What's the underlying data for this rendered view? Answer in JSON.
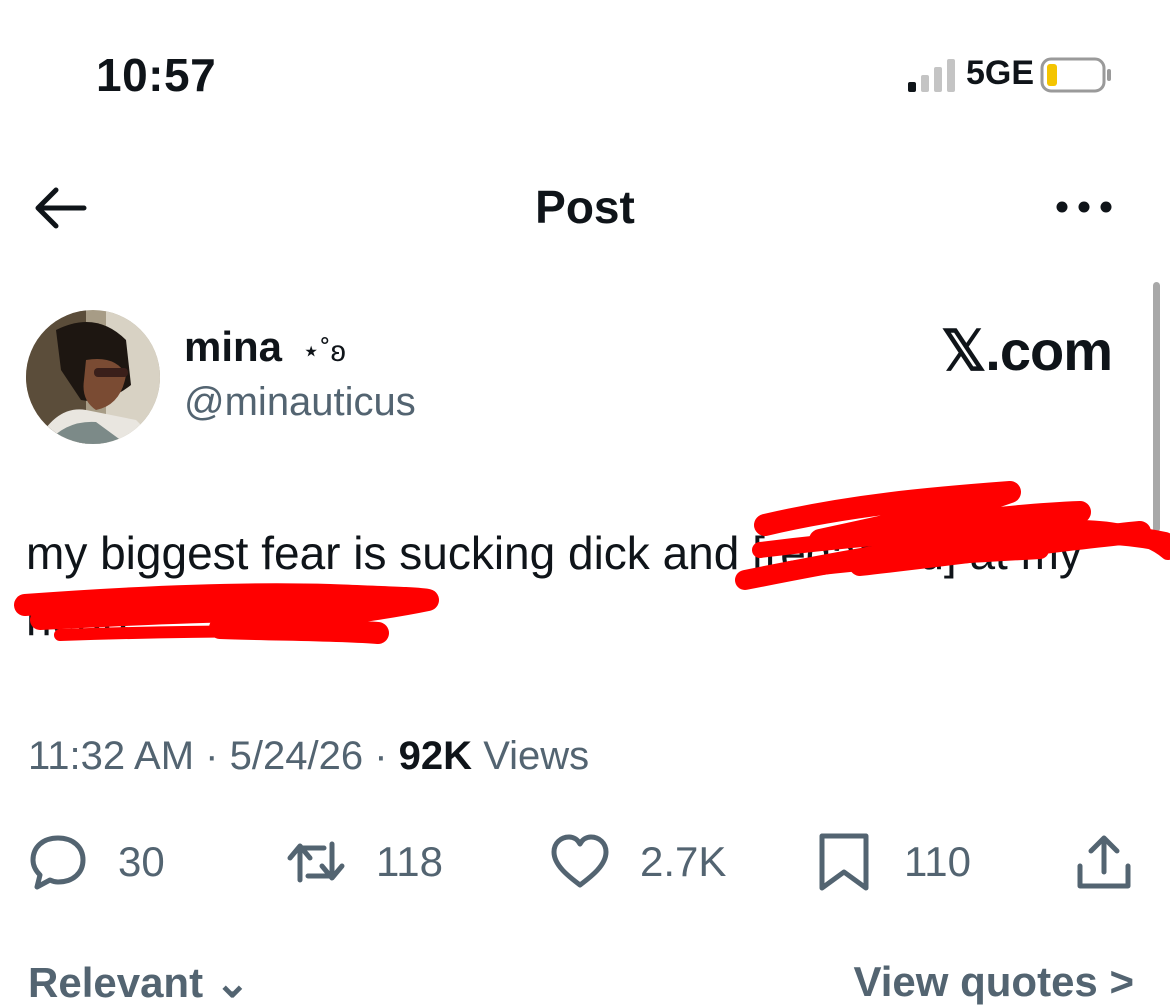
{
  "status": {
    "time": "10:57",
    "network": "5GE"
  },
  "header": {
    "title": "Post",
    "back_icon": "arrow-left-icon",
    "more_icon": "more-horizontal-icon"
  },
  "author": {
    "name": "mina",
    "name_symbol": "⋆˚ʚ",
    "handle": "@minauticus",
    "watermark": "𝕏.com"
  },
  "tweet": {
    "text": "my biggest fear is sucking dick and [redacted] at my head"
  },
  "meta": {
    "time": "11:32 AM",
    "date": "5/24/26",
    "views_count": "92K",
    "views_label": "Views",
    "separator": "·"
  },
  "actions": {
    "replies": "30",
    "reposts": "118",
    "likes": "2.7K",
    "bookmarks": "110"
  },
  "footer": {
    "left": "Relevant ⌄",
    "right": "View quotes >"
  },
  "colors": {
    "text": "#0f1419",
    "secondary": "#536471",
    "scribble": "#ff0000",
    "battery": "#f4c400"
  }
}
